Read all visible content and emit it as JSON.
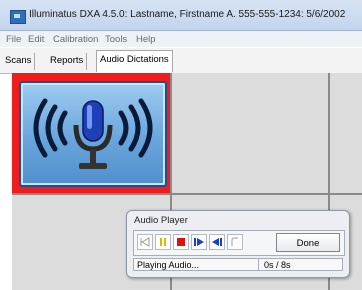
{
  "window": {
    "title": "Illuminatus DXA 4.5.0: Lastname, Firstname A. 555-555-1234: 5/6/2002"
  },
  "menu": {
    "items": [
      "File",
      "Edit",
      "Calibration",
      "Tools",
      "Help"
    ]
  },
  "tabs": [
    "Scans",
    "Reports",
    "Audio Dictations"
  ],
  "active_tab": "Audio Dictations",
  "dictation_tile": {
    "icon": "microphone-broadcast-icon",
    "selected": true,
    "highlight_color": "#ee1c1c"
  },
  "audio_player": {
    "title": "Audio Player",
    "controls": [
      {
        "name": "rewind-start-icon",
        "enabled": false
      },
      {
        "name": "pause-icon",
        "enabled": true,
        "color": "#e0b800"
      },
      {
        "name": "stop-icon",
        "enabled": true,
        "color": "#e01010"
      },
      {
        "name": "step-forward-icon",
        "enabled": true,
        "color": "#1a3fd0"
      },
      {
        "name": "step-back-icon",
        "enabled": true,
        "color": "#1a3fd0"
      },
      {
        "name": "record-icon",
        "enabled": false
      }
    ],
    "done_label": "Done",
    "status": "Playing Audio...",
    "time": "0s / 8s"
  }
}
